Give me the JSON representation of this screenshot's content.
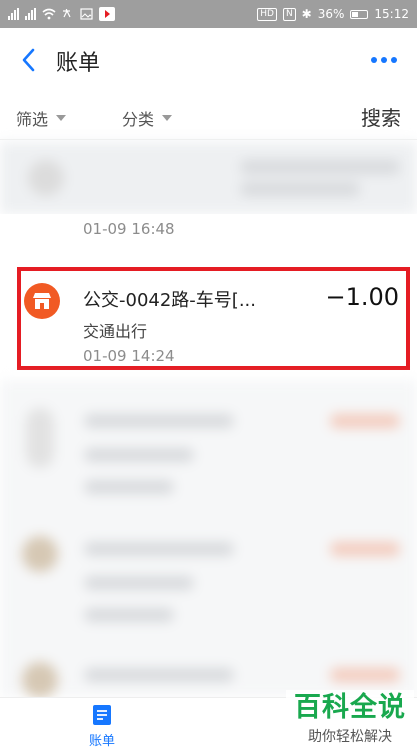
{
  "status_bar": {
    "hd_badge": "HD",
    "nfc_badge": "N",
    "bluetooth_glyph": "✱",
    "battery_percent": "36%",
    "battery_level": 0.36,
    "time": "15:12"
  },
  "header": {
    "title": "账单",
    "back_icon": "chevron-left-icon",
    "more_icon": "more-dots-icon",
    "accent_color": "#1677ff"
  },
  "filters": {
    "filter_label": "筛选",
    "category_label": "分类",
    "search_label": "搜索"
  },
  "transactions": [
    {
      "time": "01-09  16:48"
    },
    {
      "title": "公交-0042路-车号[...",
      "amount": "−1.00",
      "category": "交通出行",
      "time": "01-09  14:24",
      "icon": "shop-icon",
      "icon_color": "#f15a24",
      "highlight_color": "#e51c23"
    }
  ],
  "bottom_nav": {
    "bill_label": "账单",
    "bill_icon": "document-icon"
  },
  "watermark": {
    "main": "百科全说",
    "sub": "助你轻松解决"
  }
}
